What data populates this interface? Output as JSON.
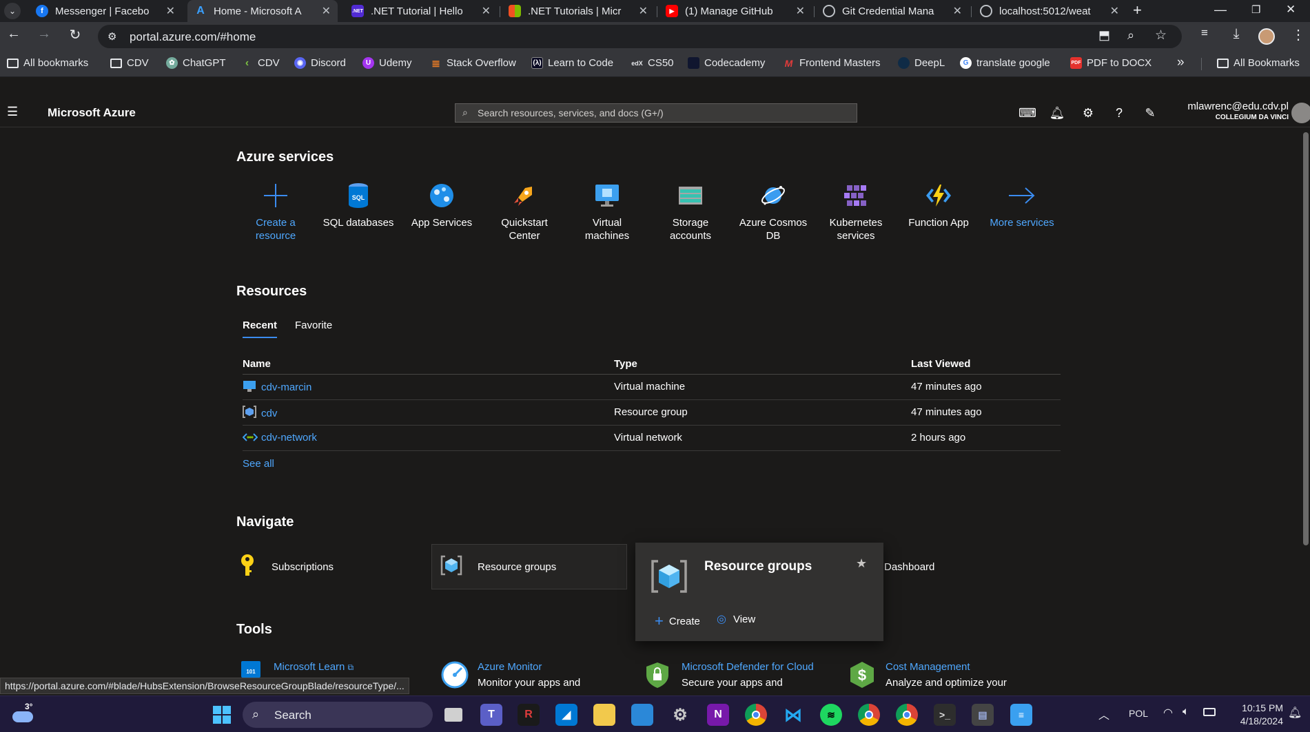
{
  "browser": {
    "tabs": [
      {
        "title": "Messenger | Facebo",
        "icon": "facebook-icon",
        "color": "#1877f2"
      },
      {
        "title": "Home - Microsoft A",
        "icon": "azure-icon",
        "color": "#0078d4",
        "active": true
      },
      {
        "title": ".NET Tutorial | Hello",
        "icon": "dotnet-icon",
        "color": "#512bd4"
      },
      {
        "title": ".NET Tutorials | Micr",
        "icon": "microsoft-icon",
        "color": "#f25022"
      },
      {
        "title": "(1) Manage GitHub",
        "icon": "youtube-icon",
        "color": "#ff0000"
      },
      {
        "title": "Git Credential Mana",
        "icon": "globe-icon",
        "color": "#9aa0a6"
      },
      {
        "title": "localhost:5012/weat",
        "icon": "globe-icon",
        "color": "#9aa0a6"
      }
    ],
    "new_tab": "+",
    "address": "portal.azure.com/#home",
    "bookmarks": [
      {
        "label": "All bookmarks",
        "icon": "folder-icon"
      },
      {
        "label": "CDV",
        "icon": "folder-icon"
      },
      {
        "label": "ChatGPT",
        "icon": "chatgpt-icon"
      },
      {
        "label": "CDV",
        "icon": "cdv-icon"
      },
      {
        "label": "Discord",
        "icon": "discord-icon"
      },
      {
        "label": "Udemy",
        "icon": "udemy-icon"
      },
      {
        "label": "Stack Overflow",
        "icon": "stackoverflow-icon"
      },
      {
        "label": "Learn to Code",
        "icon": "freecodecamp-icon"
      },
      {
        "label": "CS50",
        "icon": "edx-icon"
      },
      {
        "label": "Codecademy",
        "icon": "codecademy-icon"
      },
      {
        "label": "Frontend Masters",
        "icon": "frontendmasters-icon"
      },
      {
        "label": "DeepL",
        "icon": "deepl-icon"
      },
      {
        "label": "translate google",
        "icon": "google-icon"
      },
      {
        "label": "PDF to DOCX",
        "icon": "pdf-icon"
      }
    ],
    "bookmarks_more": "»",
    "all_bookmarks": "All Bookmarks",
    "status_url": "https://portal.azure.com/#blade/HubsExtension/BrowseResourceGroupBlade/resourceType/..."
  },
  "azure": {
    "brand": "Microsoft Azure",
    "search_placeholder": "Search resources, services, and docs (G+/)",
    "user_email": "mlawrenc@edu.cdv.pl",
    "user_org": "COLLEGIUM DA VINCI",
    "services_title": "Azure services",
    "services": [
      {
        "label": "Create a resource",
        "icon": "plus-icon",
        "link": true
      },
      {
        "label": "SQL databases",
        "icon": "sql-database-icon"
      },
      {
        "label": "App Services",
        "icon": "app-services-icon"
      },
      {
        "label": "Quickstart Center",
        "icon": "rocket-icon"
      },
      {
        "label": "Virtual machines",
        "icon": "virtual-machine-icon"
      },
      {
        "label": "Storage accounts",
        "icon": "storage-account-icon"
      },
      {
        "label": "Azure Cosmos DB",
        "icon": "cosmos-db-icon"
      },
      {
        "label": "Kubernetes services",
        "icon": "kubernetes-icon"
      },
      {
        "label": "Function App",
        "icon": "function-app-icon"
      },
      {
        "label": "More services",
        "icon": "arrow-right-icon",
        "link": true
      }
    ],
    "resources_title": "Resources",
    "resource_tabs": [
      "Recent",
      "Favorite"
    ],
    "table_headers": [
      "Name",
      "Type",
      "Last Viewed"
    ],
    "rows": [
      {
        "name": "cdv-marcin",
        "type": "Virtual machine",
        "viewed": "47 minutes ago",
        "icon": "virtual-machine-icon"
      },
      {
        "name": "cdv",
        "type": "Resource group",
        "viewed": "47 minutes ago",
        "icon": "resource-group-icon"
      },
      {
        "name": "cdv-network",
        "type": "Virtual network",
        "viewed": "2 hours ago",
        "icon": "virtual-network-icon"
      }
    ],
    "see_all": "See all",
    "navigate_title": "Navigate",
    "navigate": [
      {
        "label": "Subscriptions",
        "icon": "key-icon"
      },
      {
        "label": "Resource groups",
        "icon": "resource-group-icon"
      },
      {
        "label": "Dashboard",
        "icon": "dashboard-icon"
      }
    ],
    "popup": {
      "title": "Resource groups",
      "create": "Create",
      "view": "View"
    },
    "tools_title": "Tools",
    "tools": [
      {
        "title": "Microsoft Learn",
        "desc": "",
        "icon": "learn-icon"
      },
      {
        "title": "Azure Monitor",
        "desc": "Monitor your apps and",
        "icon": "monitor-gauge-icon"
      },
      {
        "title": "Microsoft Defender for Cloud",
        "desc": "Secure your apps and",
        "icon": "defender-shield-icon"
      },
      {
        "title": "Cost Management",
        "desc": "Analyze and optimize your",
        "icon": "cost-management-icon"
      }
    ]
  },
  "taskbar": {
    "weather": "3°",
    "search": "Search",
    "lang": "POL",
    "time": "10:15 PM",
    "date": "4/18/2024",
    "apps": [
      "windows-start-icon",
      "task-view-icon",
      "teams-icon",
      "rider-icon",
      "azure-data-studio-icon",
      "file-explorer-icon",
      "remote-desktop-icon",
      "settings-icon",
      "onenote-icon",
      "chrome-icon",
      "vscode-icon",
      "spotify-icon",
      "chrome-profile-icon",
      "chrome-active-icon",
      "terminal-icon",
      "vs-installer-icon",
      "notepad-icon"
    ]
  }
}
